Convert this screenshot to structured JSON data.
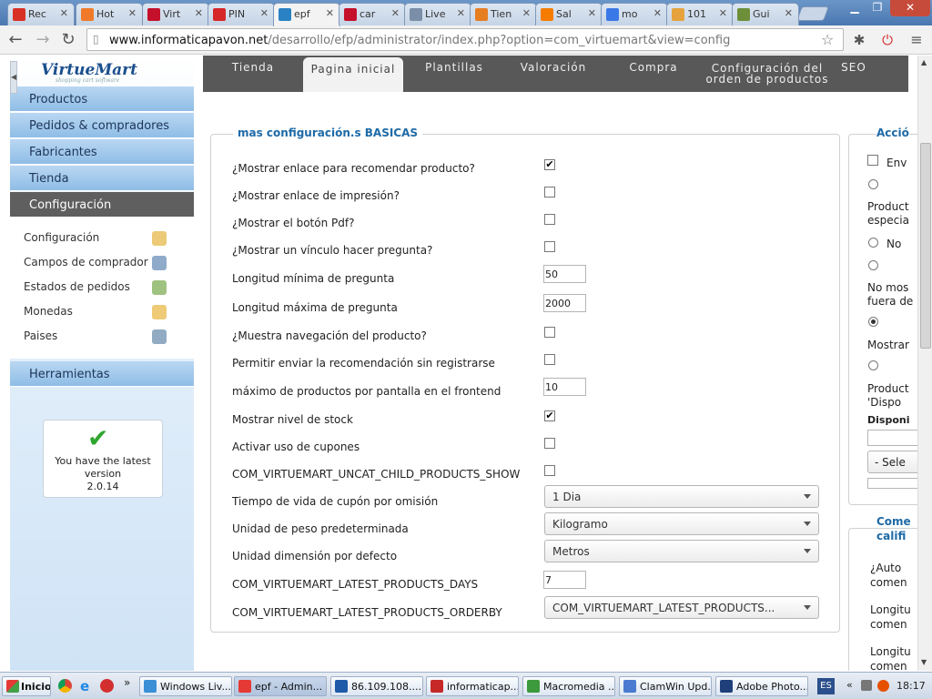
{
  "browser": {
    "tabs": [
      {
        "label": "Rec",
        "icon": "gmail-icon",
        "color": "#d93025"
      },
      {
        "label": "Hot",
        "icon": "hotmail-icon",
        "color": "#f0792a"
      },
      {
        "label": "Virt",
        "icon": "w-icon",
        "color": "#c4102b"
      },
      {
        "label": "PIN",
        "icon": "e-icon",
        "color": "#d62828"
      },
      {
        "label": "epf",
        "icon": "joomla-icon",
        "color": "#2a82c4"
      },
      {
        "label": "car",
        "icon": "w-icon",
        "color": "#c4102b"
      },
      {
        "label": "Live",
        "icon": "page-icon",
        "color": "#7a8ea8"
      },
      {
        "label": "Tien",
        "icon": "audio-icon",
        "color": "#e67e22"
      },
      {
        "label": "Sal",
        "icon": "blogger-icon",
        "color": "#f57c00"
      },
      {
        "label": "mo",
        "icon": "google-icon",
        "color": "#3b78e7"
      },
      {
        "label": "101",
        "icon": "odometer-icon",
        "color": "#e6a23c"
      },
      {
        "label": "Gui",
        "icon": "hat-icon",
        "color": "#6d8f3a"
      }
    ],
    "url_host": "www.informaticapavon.net",
    "url_path": "/desarrollo/efp/administrator/index.php?option=com_virtuemart&view=config"
  },
  "sidebar": {
    "logo": "VirtueMart",
    "logo_tagline": "shopping cart software",
    "menu": [
      {
        "label": "Productos"
      },
      {
        "label": "Pedidos & compradores"
      },
      {
        "label": "Fabricantes"
      },
      {
        "label": "Tienda"
      },
      {
        "label": "Configuración"
      }
    ],
    "subitems": [
      {
        "label": "Configuración",
        "icon": "tools-icon"
      },
      {
        "label": "Campos de comprador",
        "icon": "user-form-icon"
      },
      {
        "label": "Estados de pedidos",
        "icon": "status-icon"
      },
      {
        "label": "Monedas",
        "icon": "coins-icon"
      },
      {
        "label": "Paises",
        "icon": "globe-icon"
      }
    ],
    "tools": "Herramientas",
    "latest_line1": "You have the latest",
    "latest_line2": "version",
    "latest_version": "2.0.14"
  },
  "config_tabs": [
    {
      "label": "Tienda"
    },
    {
      "label": "Pagina inicial"
    },
    {
      "label": "Plantillas"
    },
    {
      "label": "Valoración"
    },
    {
      "label": "Compra"
    },
    {
      "label": "Configuración del orden de productos"
    },
    {
      "label": "SEO"
    }
  ],
  "basic": {
    "legend": "mas configuración.s BASICAS",
    "rows": [
      {
        "label": "¿Mostrar enlace para recomendar producto?",
        "type": "checkbox",
        "checked": true
      },
      {
        "label": "¿Mostrar enlace de impresión?",
        "type": "checkbox",
        "checked": false
      },
      {
        "label": "¿Mostrar el botón Pdf?",
        "type": "checkbox",
        "checked": false
      },
      {
        "label": "¿Mostrar un vínculo hacer pregunta?",
        "type": "checkbox",
        "checked": false
      },
      {
        "label": "Longitud mínima de pregunta",
        "type": "text",
        "value": "50"
      },
      {
        "label": "Longitud máxima de pregunta",
        "type": "text",
        "value": "2000"
      },
      {
        "label": "¿Muestra navegación del producto?",
        "type": "checkbox",
        "checked": false
      },
      {
        "label": "Permitir enviar la recomendación sin registrarse",
        "type": "checkbox",
        "checked": false
      },
      {
        "label": "máximo de productos por pantalla en el frontend",
        "type": "text",
        "value": "10"
      },
      {
        "label": "Mostrar nivel de stock",
        "type": "checkbox",
        "checked": true
      },
      {
        "label": "Activar uso de cupones",
        "type": "checkbox",
        "checked": false
      },
      {
        "label": "COM_VIRTUEMART_UNCAT_CHILD_PRODUCTS_SHOW",
        "type": "checkbox",
        "checked": false
      },
      {
        "label": "Tiempo de vida de cupón por omisión",
        "type": "select",
        "value": "1 Dia"
      },
      {
        "label": "Unidad de peso predeterminada",
        "type": "select",
        "value": "Kilogramo"
      },
      {
        "label": "Unidad dimensión por defecto",
        "type": "select",
        "value": "Metros"
      },
      {
        "label": "COM_VIRTUEMART_LATEST_PRODUCTS_DAYS",
        "type": "text",
        "value": "7"
      },
      {
        "label": "COM_VIRTUEMART_LATEST_PRODUCTS_ORDERBY",
        "type": "select",
        "value": "COM_VIRTUEMART_LATEST_PRODUCTS..."
      }
    ]
  },
  "right_panel": {
    "legend1": "Acció",
    "env": "Env",
    "product_special_1": "Product",
    "product_special_2": "especia",
    "no": "No",
    "nomos_1": "No mos",
    "nomos_2": "fuera de",
    "mostrar": "Mostrar",
    "disp_1": "Product",
    "disp_2": "'Dispo",
    "disponi": "Disponi",
    "sele": "- Sele",
    "legend2_1": "Come",
    "legend2_2": "califi",
    "auto_1": "¿Auto",
    "auto_2": "comen",
    "long1_1": "Longitu",
    "long1_2": "comen",
    "long2_1": "Longitu",
    "long2_2": "comen"
  },
  "taskbar": {
    "start": "Inicio",
    "items": [
      {
        "label": "Windows Liv...",
        "color": "#3a8fd6"
      },
      {
        "label": "epf - Admin...",
        "color": "#e53935"
      },
      {
        "label": "86.109.108....",
        "color": "#1e5aa8"
      },
      {
        "label": "informaticap...",
        "color": "#c62828"
      },
      {
        "label": "Macromedia ...",
        "color": "#3c9a3c"
      },
      {
        "label": "ClamWin Upd...",
        "color": "#4a7bd0"
      },
      {
        "label": "Adobe Photo...",
        "color": "#1f3f7a"
      }
    ],
    "lang": "ES",
    "time": "18:17"
  }
}
